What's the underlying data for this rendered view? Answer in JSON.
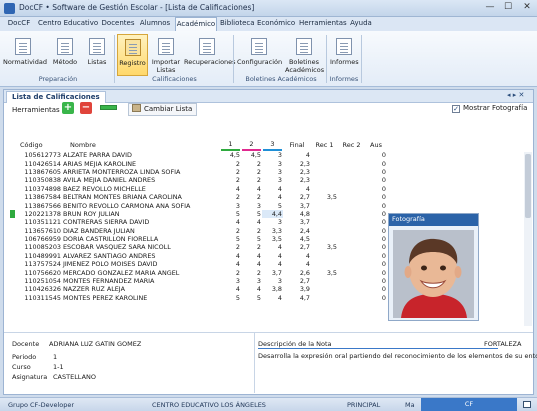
{
  "window": {
    "title": "DocCF • Software de Gestión Escolar - [Lista de Calificaciones]",
    "min": "—",
    "max": "☐",
    "close": "✕"
  },
  "menu": [
    "DocCF",
    "Centro Educativo",
    "Docentes",
    "Alumnos",
    "Académico",
    "Biblioteca",
    "Económico",
    "Herramientas",
    "Ayuda"
  ],
  "ribbon": {
    "buttons": [
      "Normatividad",
      "Método",
      "Listas",
      "Registro",
      "Importar Listas",
      "Recuperaciones",
      "Configuración",
      "Boletines Académicos",
      "Informes"
    ],
    "groups": [
      "Preparación",
      "Calificaciones",
      "Boletines Académicos",
      "Informes"
    ]
  },
  "panel": {
    "tab": "Lista de Calificaciones",
    "controls": "◂ ▸ ✕",
    "pin": "▾"
  },
  "toolbar": {
    "label": "Herramientas",
    "add": "+",
    "remove": "−",
    "change_list": "Cambiar Lista",
    "show_photo": "Mostrar Fotografía",
    "show_photo_checked": "✓"
  },
  "grid": {
    "columns": [
      "Código",
      "Nombre",
      "1",
      "2",
      "3",
      "Final",
      "Rec 1",
      "Rec 2",
      "Aus"
    ],
    "header_bar_colors": [
      "#2eaa3e",
      "#e0298f",
      "#1f8fd6"
    ],
    "rows": [
      [
        "105612773",
        "ALZATE PARRA DAVID",
        "4,5",
        "4,5",
        "3",
        "4",
        "",
        "",
        "0"
      ],
      [
        "110426514",
        "ARIAS MEJIA KAROLINE",
        "2",
        "2",
        "3",
        "2,3",
        "",
        "",
        "0"
      ],
      [
        "113867605",
        "ARRIETA MONTERROZA LINDA SOFIA",
        "2",
        "2",
        "3",
        "2,3",
        "",
        "",
        "0"
      ],
      [
        "110350838",
        "AVILA MEJIA DANIEL ANDRES",
        "2",
        "2",
        "3",
        "2,3",
        "",
        "",
        "0"
      ],
      [
        "110374898",
        "BAEZ REVOLLO MICHELLE",
        "4",
        "4",
        "4",
        "4",
        "",
        "",
        "0"
      ],
      [
        "113867584",
        "BELTRAN MONTES BRIANA CAROLINA",
        "2",
        "2",
        "4",
        "2,7",
        "3,5",
        "",
        "0"
      ],
      [
        "113867566",
        "BENITO REVOLLO CARMONA ANA SOFIA",
        "3",
        "3",
        "5",
        "3,7",
        "",
        "",
        "0"
      ],
      [
        "120221378",
        "BRUN ROY JULIAN",
        "5",
        "5",
        "4,4",
        "4,8",
        "",
        "",
        "0"
      ],
      [
        "110351121",
        "CONTRERAS SIERRA DAVID",
        "4",
        "4",
        "3",
        "3,7",
        "",
        "",
        "0"
      ],
      [
        "113657610",
        "DIAZ BANDERA JULIAN",
        "2",
        "2",
        "3,3",
        "2,4",
        "",
        "",
        "0"
      ],
      [
        "106766959",
        "DORIA CASTRILLON FIORELLA",
        "5",
        "5",
        "3,5",
        "4,5",
        "",
        "",
        "0"
      ],
      [
        "110085203",
        "ESCOBAR VASQUEZ SARA NICOLL",
        "2",
        "2",
        "4",
        "2,7",
        "3,5",
        "",
        "0"
      ],
      [
        "110489991",
        "ALVAREZ SANTIAGO ANDRES",
        "4",
        "4",
        "4",
        "4",
        "",
        "",
        "0"
      ],
      [
        "113757524",
        "JIMENEZ POLO MOISES DAVID",
        "4",
        "4",
        "4",
        "4",
        "",
        "",
        "0"
      ],
      [
        "110756620",
        "MERCADO GONZALEZ MARIA ANGEL",
        "2",
        "2",
        "3,7",
        "2,6",
        "3,5",
        "",
        "0"
      ],
      [
        "110251054",
        "MONTES FERNANDEZ MARIA",
        "3",
        "3",
        "3",
        "2,7",
        "",
        "",
        "0"
      ],
      [
        "110426326",
        "NAZZER RUZ ALEJA",
        "4",
        "4",
        "3,8",
        "3,9",
        "",
        "",
        "0"
      ],
      [
        "110311545",
        "MONTES PEREZ KAROLINE",
        "5",
        "5",
        "4",
        "4,7",
        "",
        "",
        "0"
      ]
    ],
    "indicator_row": 7,
    "edit_row": 7,
    "edit_col": 4
  },
  "photo": {
    "title": "Fotografía"
  },
  "info_left": {
    "docente_label": "Docente",
    "docente": "ADRIANA LUZ GATIN GOMEZ",
    "periodo_label": "Periodo",
    "periodo": "1",
    "curso_label": "Curso",
    "curso": "1-1",
    "asignatura_label": "Asignatura",
    "asignatura": "CASTELLANO"
  },
  "info_right": {
    "desc_label": "Descripción de la Nota",
    "level": "FORTALEZA",
    "desc": "Desarrolla la expresión oral partiendo del reconocimiento de los elementos de su entorno"
  },
  "status": {
    "group": "Grupo CF-Developer",
    "center": "CENTRO EDUCATIVO LOS ÁNGELES",
    "mode": "PRINCIPAL",
    "user": "Ma",
    "badge": "CF"
  }
}
